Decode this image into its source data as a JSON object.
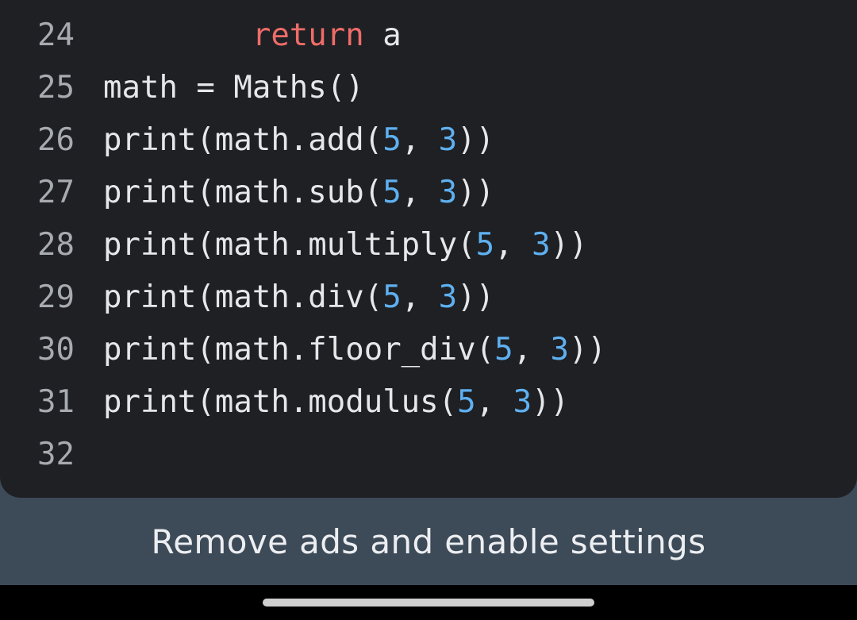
{
  "editor": {
    "lines": [
      {
        "number": "24",
        "tokens": [
          {
            "text": "        ",
            "kind": "plain"
          },
          {
            "text": "return",
            "kind": "keyword"
          },
          {
            "text": " a",
            "kind": "plain"
          }
        ]
      },
      {
        "number": "25",
        "tokens": [
          {
            "text": "math = Maths()",
            "kind": "plain"
          }
        ]
      },
      {
        "number": "26",
        "tokens": [
          {
            "text": "print(math.add(",
            "kind": "plain"
          },
          {
            "text": "5",
            "kind": "number"
          },
          {
            "text": ", ",
            "kind": "plain"
          },
          {
            "text": "3",
            "kind": "number"
          },
          {
            "text": "))",
            "kind": "plain"
          }
        ]
      },
      {
        "number": "27",
        "tokens": [
          {
            "text": "print(math.sub(",
            "kind": "plain"
          },
          {
            "text": "5",
            "kind": "number"
          },
          {
            "text": ", ",
            "kind": "plain"
          },
          {
            "text": "3",
            "kind": "number"
          },
          {
            "text": "))",
            "kind": "plain"
          }
        ]
      },
      {
        "number": "28",
        "tokens": [
          {
            "text": "print(math.multiply(",
            "kind": "plain"
          },
          {
            "text": "5",
            "kind": "number"
          },
          {
            "text": ", ",
            "kind": "plain"
          },
          {
            "text": "3",
            "kind": "number"
          },
          {
            "text": "))",
            "kind": "plain"
          }
        ]
      },
      {
        "number": "29",
        "tokens": [
          {
            "text": "print(math.div(",
            "kind": "plain"
          },
          {
            "text": "5",
            "kind": "number"
          },
          {
            "text": ", ",
            "kind": "plain"
          },
          {
            "text": "3",
            "kind": "number"
          },
          {
            "text": "))",
            "kind": "plain"
          }
        ]
      },
      {
        "number": "30",
        "tokens": [
          {
            "text": "print(math.floor_div(",
            "kind": "plain"
          },
          {
            "text": "5",
            "kind": "number"
          },
          {
            "text": ", ",
            "kind": "plain"
          },
          {
            "text": "3",
            "kind": "number"
          },
          {
            "text": "))",
            "kind": "plain"
          }
        ]
      },
      {
        "number": "31",
        "tokens": [
          {
            "text": "print(math.modulus(",
            "kind": "plain"
          },
          {
            "text": "5",
            "kind": "number"
          },
          {
            "text": ", ",
            "kind": "plain"
          },
          {
            "text": "3",
            "kind": "number"
          },
          {
            "text": "))",
            "kind": "plain"
          }
        ]
      },
      {
        "number": "32",
        "tokens": []
      }
    ]
  },
  "banner": {
    "label": "Remove ads and enable settings"
  },
  "colors": {
    "editor_background": "#1e2024",
    "banner_background": "#3d4a58",
    "keyword": "#ef6c68",
    "number": "#5fb0f0",
    "plain_text": "#e6e7e9",
    "line_number": "#a7abb0"
  }
}
